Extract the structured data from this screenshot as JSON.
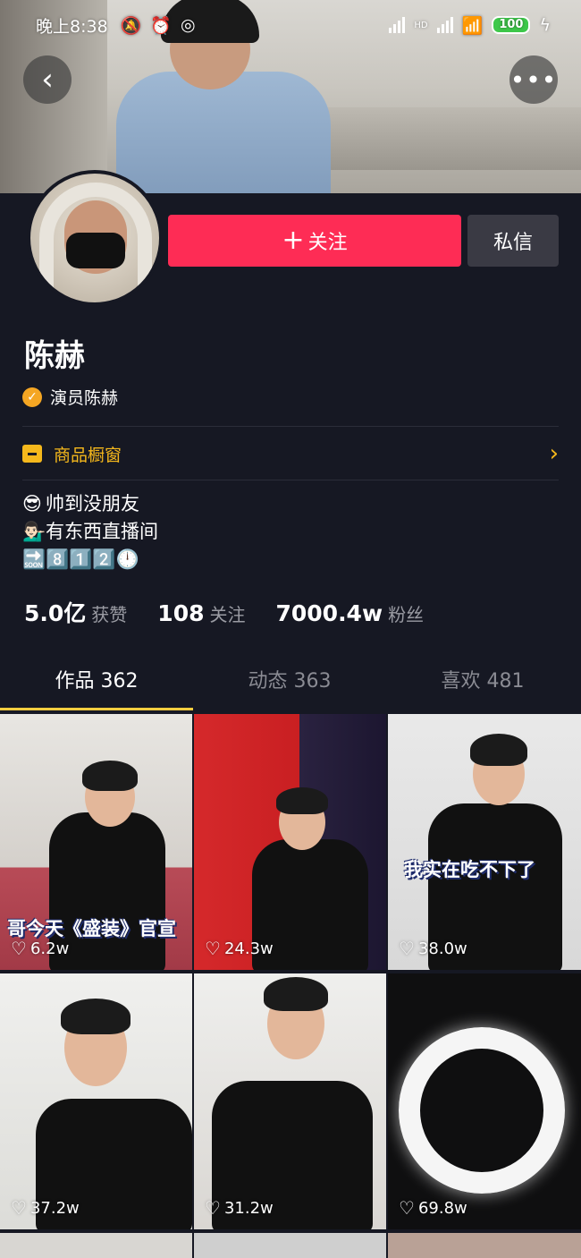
{
  "status_bar": {
    "time": "晚上8:38",
    "network_label": "HD",
    "battery": "100",
    "icons": [
      "mute-bell-icon",
      "alarm-icon",
      "sync-icon",
      "signal-icon",
      "wifi-icon",
      "battery-icon",
      "charging-icon"
    ]
  },
  "header": {
    "back_icon": "chevron-left-icon",
    "more_icon": "more-horizontal-icon"
  },
  "profile": {
    "follow_label": "关注",
    "message_label": "私信",
    "name": "陈赫",
    "verified_label": "演员陈赫",
    "shop_label": "商品橱窗",
    "bio": [
      {
        "emoji": "😎",
        "text": "帅到没朋友"
      },
      {
        "emoji": "💁🏻‍♂️",
        "text": "有东西直播间"
      },
      {
        "emoji": "🔜",
        "text": "8️⃣1️⃣2️⃣🕛"
      }
    ],
    "stats": [
      {
        "value": "5.0亿",
        "label": "获赞"
      },
      {
        "value": "108",
        "label": "关注"
      },
      {
        "value": "7000.4w",
        "label": "粉丝"
      }
    ]
  },
  "tabs": [
    {
      "label": "作品 362",
      "active": true
    },
    {
      "label": "动态 363",
      "active": false
    },
    {
      "label": "喜欢 481",
      "active": false
    }
  ],
  "videos": [
    {
      "likes": "6.2w",
      "caption": "哥今天《盛装》官宣"
    },
    {
      "likes": "24.3w",
      "caption": ""
    },
    {
      "likes": "38.0w",
      "caption": "我实在吃不下了"
    },
    {
      "likes": "37.2w",
      "caption": ""
    },
    {
      "likes": "31.2w",
      "caption": ""
    },
    {
      "likes": "69.8w",
      "caption": ""
    }
  ],
  "colors": {
    "background": "#161823",
    "follow_button": "#fe2c55",
    "accent_yellow": "#facd3f",
    "shop_gold": "#f5b81c"
  }
}
